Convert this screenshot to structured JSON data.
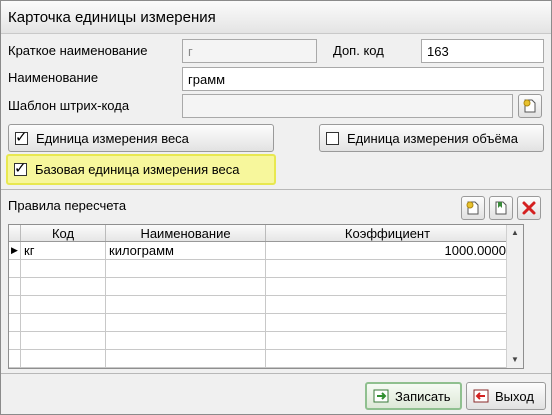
{
  "window": {
    "title": "Карточка единицы измерения"
  },
  "form": {
    "short_name_label": "Краткое наименование",
    "short_name_value": "г",
    "extra_code_label": "Доп. код",
    "extra_code_value": "163",
    "name_label": "Наименование",
    "name_value": "грамм",
    "barcode_label": "Шаблон штрих-кода",
    "barcode_value": ""
  },
  "checkboxes": {
    "weight_unit": {
      "label": "Единица измерения веса",
      "checked": true
    },
    "volume_unit": {
      "label": "Единица измерения объёма",
      "checked": false
    },
    "base_weight_unit": {
      "label": "Базовая единица измерения веса",
      "checked": true
    }
  },
  "conversion": {
    "title": "Правила пересчета",
    "columns": [
      "Код",
      "Наименование",
      "Коэффициент"
    ],
    "rows": [
      {
        "code": "кг",
        "name": "килограмм",
        "coef": "1000.0000"
      }
    ]
  },
  "buttons": {
    "save": "Записать",
    "exit": "Выход"
  },
  "colors": {
    "highlight": "#f7f79c",
    "delete_red": "#d42020",
    "add_yellow": "#e8c22e"
  }
}
